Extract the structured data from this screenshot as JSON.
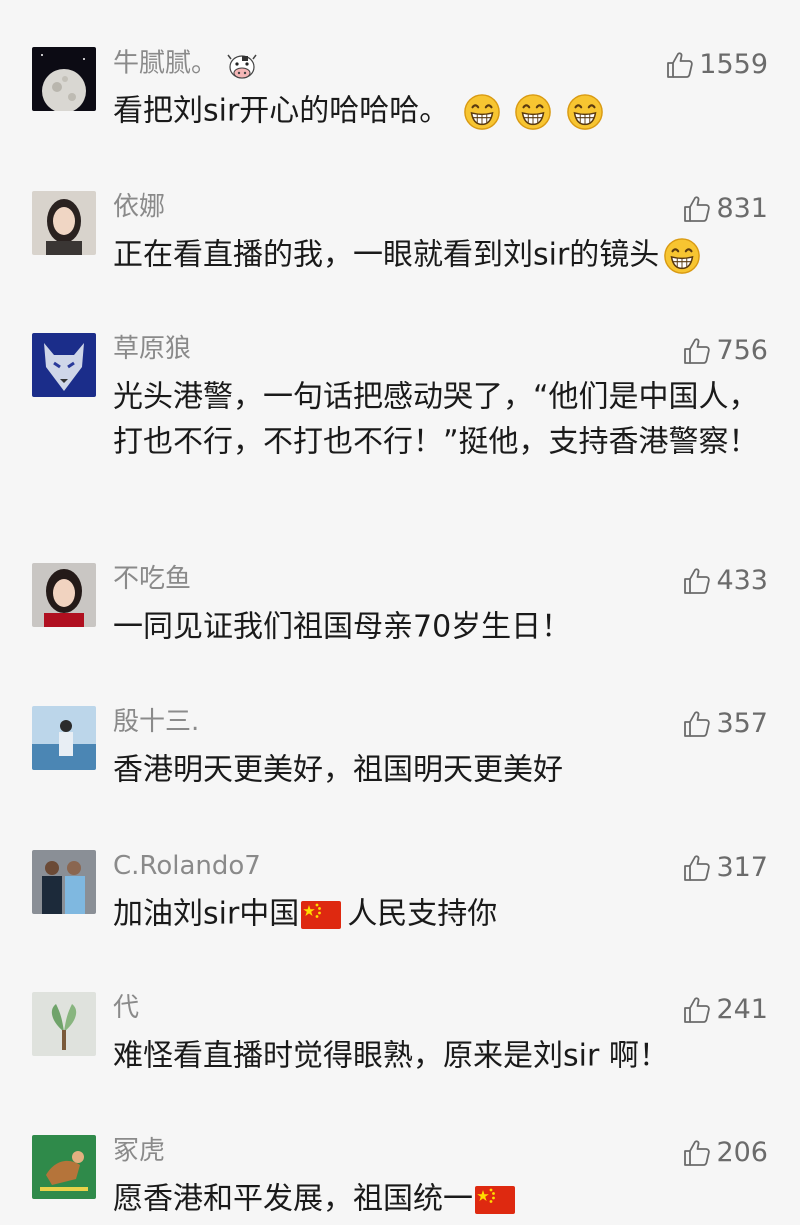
{
  "comments": [
    {
      "name": "牛腻腻。",
      "likes": "1559",
      "text": "看把刘sir开心的哈哈哈。"
    },
    {
      "name": "依娜",
      "likes": "831",
      "text": "正在看直播的我，一眼就看到刘sir的镜头"
    },
    {
      "name": "草原狼",
      "likes": "756",
      "text": "光头港警，一句话把感动哭了，“他们是中国人，打也不行，不打也不行！”挺他，支持香港警察！"
    },
    {
      "name": "不吃鱼",
      "likes": "433",
      "text": "一同见证我们祖国母亲70岁生日！"
    },
    {
      "name": "殷十三.",
      "likes": "357",
      "text": "香港明天更美好，祖国明天更美好"
    },
    {
      "name": "C.Rolando7",
      "likes": "317",
      "text_before": "加油刘sir中国",
      "text_after": "人民支持你"
    },
    {
      "name": "代",
      "likes": "241",
      "text": "难怪看直播时觉得眼熟，原来是刘sir 啊！"
    },
    {
      "name": "冢虎",
      "likes": "206",
      "text": "愿香港和平发展，祖国统一"
    }
  ],
  "icons": {
    "like": "thumbs-up-icon",
    "grin": "grinning-emoji-icon",
    "flag": "china-flag-icon",
    "badge": "cow-emoji-icon"
  },
  "colors": {
    "background": "#f6f6f6",
    "name": "#8a8a8a",
    "text": "#1a1a1a",
    "likes": "#6b6b6b"
  }
}
